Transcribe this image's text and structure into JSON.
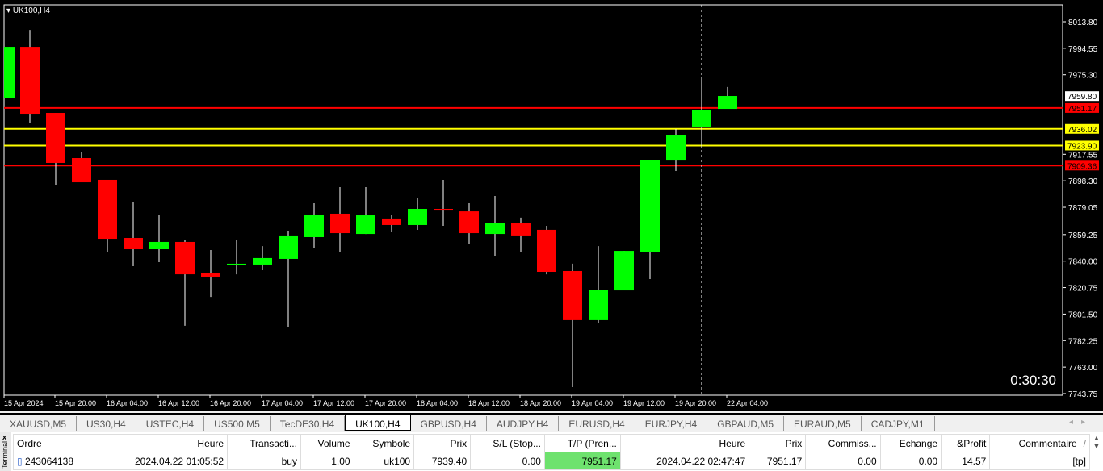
{
  "chart": {
    "symbol": "UK100,H4",
    "countdown": "0:30:30",
    "colors": {
      "bull": "#00ff00",
      "bear": "#ff0000",
      "support": "#ffff00",
      "resistance": "#ff0000",
      "bg": "#000000"
    },
    "price_ticks": [
      "8013.80",
      "7994.55",
      "7975.30",
      "7917.55",
      "7898.30",
      "7879.05",
      "7859.25",
      "7840.00",
      "7820.75",
      "7801.50",
      "7782.25",
      "7763.00",
      "7743.75"
    ],
    "current_price": "7959.80",
    "levels": [
      {
        "price": "7951.17",
        "color": "#ff0000"
      },
      {
        "price": "7936.02",
        "color": "#ffff00"
      },
      {
        "price": "7923.90",
        "color": "#ffff00"
      },
      {
        "price": "7909.36",
        "color": "#ff0000"
      }
    ],
    "time_labels": [
      "15 Apr 2024",
      "15 Apr 20:00",
      "16 Apr 04:00",
      "16 Apr 12:00",
      "16 Apr 20:00",
      "17 Apr 04:00",
      "17 Apr 12:00",
      "17 Apr 20:00",
      "18 Apr 04:00",
      "18 Apr 12:00",
      "18 Apr 20:00",
      "19 Apr 04:00",
      "19 Apr 12:00",
      "19 Apr 20:00",
      "22 Apr 04:00"
    ],
    "ohlc": [
      [
        7958.7,
        7995.6,
        7958.7,
        7995.6
      ],
      [
        7995.6,
        8007.9,
        7940.6,
        7947.0
      ],
      [
        7947.6,
        7947.6,
        7894.9,
        7911.3
      ],
      [
        7914.8,
        7919.5,
        7897.2,
        7897.2
      ],
      [
        7899.0,
        7899.0,
        7846.3,
        7856.2
      ],
      [
        7856.8,
        7883.2,
        7836.3,
        7848.6
      ],
      [
        7848.6,
        7873.2,
        7839.2,
        7853.9
      ],
      [
        7853.9,
        7855.6,
        7793.0,
        7830.4
      ],
      [
        7831.6,
        7848.0,
        7814.0,
        7828.7
      ],
      [
        7836.9,
        7855.6,
        7830.4,
        7838.1
      ],
      [
        7837.5,
        7850.9,
        7833.4,
        7842.2
      ],
      [
        7841.6,
        7861.5,
        7792.4,
        7858.6
      ],
      [
        7857.4,
        7882.0,
        7849.8,
        7873.8
      ],
      [
        7874.4,
        7893.7,
        7846.3,
        7860.3
      ],
      [
        7859.7,
        7893.7,
        7859.7,
        7873.2
      ],
      [
        7870.9,
        7873.8,
        7860.9,
        7866.2
      ],
      [
        7866.2,
        7886.1,
        7862.7,
        7877.9
      ],
      [
        7877.9,
        7899.0,
        7865.6,
        7876.7
      ],
      [
        7876.1,
        7882.0,
        7852.1,
        7860.3
      ],
      [
        7859.7,
        7887.3,
        7843.9,
        7867.9
      ],
      [
        7867.9,
        7871.5,
        7846.3,
        7858.6
      ],
      [
        7862.7,
        7865.6,
        7830.4,
        7832.2
      ],
      [
        7832.8,
        7838.1,
        7748.4,
        7797.1
      ],
      [
        7797.1,
        7850.9,
        7795.3,
        7819.3
      ],
      [
        7818.7,
        7847.4,
        7818.7,
        7847.4
      ],
      [
        7846.3,
        7913.6,
        7826.9,
        7913.6
      ],
      [
        7913.0,
        7935.9,
        7905.4,
        7931.2
      ],
      [
        7937.6,
        7973.4,
        7924.2,
        7949.9
      ],
      [
        7950.5,
        7966.4,
        7950.5,
        7959.9
      ]
    ]
  },
  "tabs": [
    "XAUUSD,M5",
    "US30,H4",
    "USTEC,H4",
    "US500,M5",
    "TecDE30,H4",
    "UK100,H4",
    "GBPUSD,H4",
    "AUDJPY,H4",
    "EURUSD,H4",
    "EURJPY,H4",
    "GBPAUD,M5",
    "EURAUD,M5",
    "CADJPY,M1"
  ],
  "active_tab": "UK100,H4",
  "terminal": {
    "label": "Terminal",
    "close": "x",
    "columns": [
      "Ordre",
      "Heure",
      "Transacti...",
      "Volume",
      "Symbole",
      "Prix",
      "S/L (Stop...",
      "T/P (Pren...",
      "Heure",
      "Prix",
      "Commiss...",
      "Echange",
      "&Profit",
      "Commentaire"
    ],
    "sort_icon": "/",
    "rows": [
      [
        "243064138",
        "2024.04.22 01:05:52",
        "buy",
        "1.00",
        "uk100",
        "7939.40",
        "0.00",
        "7951.17",
        "2024.04.22 02:47:47",
        "7951.17",
        "0.00",
        "0.00",
        "14.57",
        "[tp]"
      ]
    ]
  }
}
